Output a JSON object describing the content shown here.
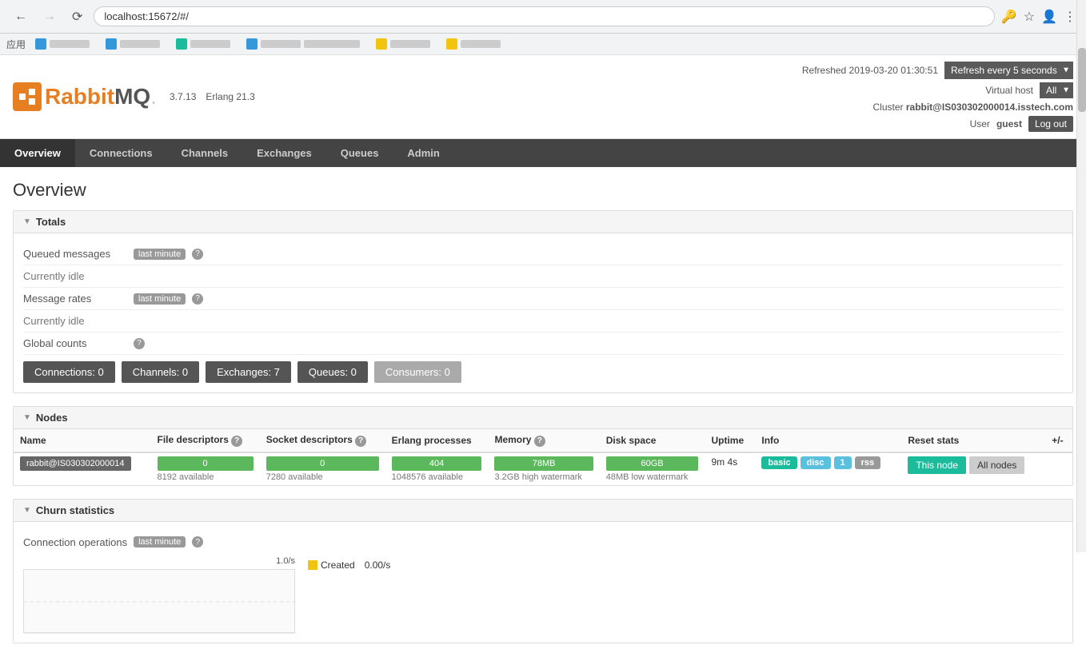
{
  "browser": {
    "url": "localhost:15672/#/",
    "back_disabled": false,
    "forward_disabled": true
  },
  "bookmarks": [
    {
      "icon_color": "orange",
      "label": "应用"
    },
    {
      "icon_color": "blue",
      "label": ""
    },
    {
      "icon_color": "blue",
      "label": ""
    },
    {
      "icon_color": "cyan",
      "label": ""
    },
    {
      "icon_color": "blue",
      "label": ""
    },
    {
      "icon_color": "yellow",
      "label": ""
    },
    {
      "icon_color": "yellow",
      "label": ""
    }
  ],
  "header": {
    "version": "3.7.13",
    "erlang": "Erlang 21.3",
    "refreshed": "Refreshed 2019-03-20 01:30:51",
    "refresh_label": "Refresh every 5 seconds",
    "virtual_host_label": "Virtual host",
    "virtual_host_value": "All",
    "cluster_label": "Cluster",
    "cluster_value": "rabbit@IS030302000014.isstech.com",
    "user_label": "User",
    "user_value": "guest",
    "logout_label": "Log out"
  },
  "nav": {
    "items": [
      {
        "label": "Overview",
        "active": true
      },
      {
        "label": "Connections",
        "active": false
      },
      {
        "label": "Channels",
        "active": false
      },
      {
        "label": "Exchanges",
        "active": false
      },
      {
        "label": "Queues",
        "active": false
      },
      {
        "label": "Admin",
        "active": false
      }
    ]
  },
  "page": {
    "title": "Overview",
    "sections": {
      "totals": {
        "header": "Totals",
        "queued_messages_label": "Queued messages",
        "queued_badge": "last minute",
        "queued_help": "?",
        "currently_idle_1": "Currently idle",
        "message_rates_label": "Message rates",
        "message_rates_badge": "last minute",
        "message_rates_help": "?",
        "currently_idle_2": "Currently idle",
        "global_counts_label": "Global counts",
        "global_counts_help": "?"
      },
      "counts": {
        "connections": "Connections: 0",
        "channels": "Channels: 0",
        "exchanges": "Exchanges: 7",
        "queues": "Queues: 0",
        "consumers": "Consumers: 0"
      },
      "nodes": {
        "header": "Nodes",
        "columns": [
          "Name",
          "File descriptors",
          "Socket descriptors",
          "Erlang processes",
          "Memory",
          "Disk space",
          "Uptime",
          "Info",
          "Reset stats",
          "+/-"
        ],
        "rows": [
          {
            "name": "rabbit@IS030302000014",
            "file_descriptors": "0",
            "file_descriptors_sub": "8192 available",
            "socket_descriptors": "0",
            "socket_descriptors_sub": "7280 available",
            "erlang_processes": "404",
            "erlang_processes_sub": "1048576 available",
            "memory": "78MB",
            "memory_sub": "3.2GB high watermark",
            "disk_space": "60GB",
            "disk_space_sub": "48MB low watermark",
            "uptime": "9m 4s",
            "info_badges": [
              "basic",
              "disc",
              "1",
              "rss"
            ],
            "this_node": "This node",
            "all_nodes": "All nodes"
          }
        ],
        "file_descriptors_help": "?",
        "socket_descriptors_help": "?",
        "memory_help": "?"
      },
      "churn": {
        "header": "Churn statistics",
        "connection_ops_label": "Connection operations",
        "connection_ops_badge": "last minute",
        "connection_ops_help": "?",
        "y_axis": "1.0/s",
        "created_label": "Created",
        "created_value": "0.00/s",
        "legend_color": "#f1c40f"
      }
    }
  }
}
